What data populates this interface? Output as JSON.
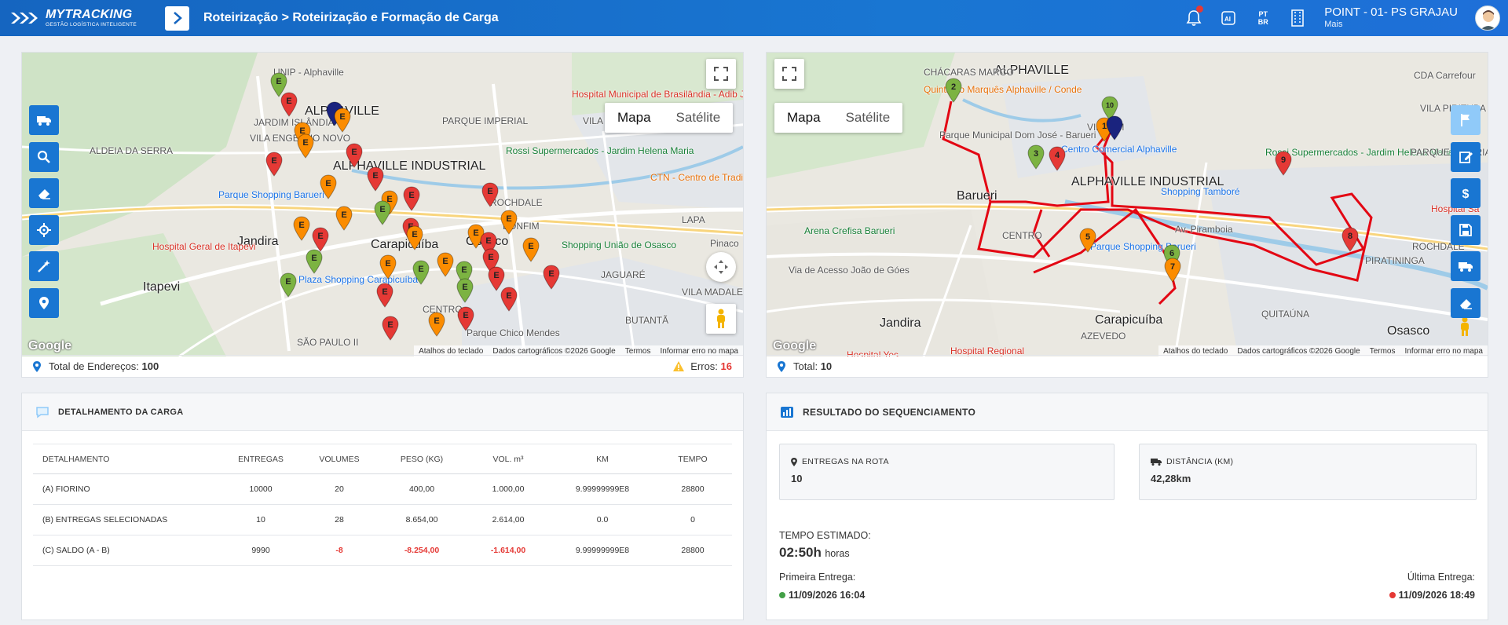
{
  "header": {
    "logo_main": "MYTRACKING",
    "logo_sub": "GESTÃO LOGÍSTICA INTELIGENTE",
    "breadcrumb": "Roteirização > Roteirização e Formação de Carga",
    "lang_top": "PT",
    "lang_bottom": "BR",
    "user_name": "POINT - 01- PS GRAJAU",
    "user_sub": "Mais"
  },
  "map_left": {
    "type_map": "Mapa",
    "type_satellite": "Satélite",
    "footer": [
      "Atalhos do teclado",
      "Dados cartográficos ©2026 Google",
      "Termos",
      "Informar erro no mapa"
    ],
    "google": "Google",
    "labels": [
      "UNIP - Alphaville",
      "ALPHAVILLE",
      "JARDIM ISLÂNDIA",
      "VILA ENGENHO NOVO",
      "ALDEIA DA SERRA",
      "Parque Shopping Barueri",
      "Jandira",
      "Hospital Geral de Itapevi",
      "Itapevi",
      "Carapicuíba",
      "Plaza Shopping Carapicuíba",
      "SÃO PAULO II",
      "Osasco",
      "ROCHDALE",
      "LAPA",
      "VILA MADALENA",
      "BUTANTÃ",
      "Rossi Supermercados - Jardim Helena Maria",
      "CTN - Centro de Tradições Nordestinas",
      "Shopping União de Osasco",
      "Hospital Municipal de Brasilândia - Adib Jatene",
      "VILA PIRITUBA",
      "PARQUE IMPERIAL",
      "ALPHAVILLE INDUSTRIAL",
      "Parque Chico Mendes",
      "JAGUARÉ",
      "Pinaco",
      "CENTRO",
      "BONFIM"
    ],
    "status_label": "Total de Endereços:",
    "status_value": "100",
    "errors_label": "Erros:",
    "errors_value": "16"
  },
  "map_right": {
    "type_map": "Mapa",
    "type_satellite": "Satélite",
    "footer": [
      "Atalhos do teclado",
      "Dados cartográficos ©2026 Google",
      "Termos",
      "Informar erro no mapa"
    ],
    "google": "Google",
    "labels": [
      "ALPHAVILLE",
      "CHÁCARAS MARCO",
      "Quinta do Marquês Alphaville / Conde",
      "Parque Municipal Dom José - Barueri",
      "Centro Comercial Alphaville",
      "Barueri",
      "ALPHAVILLE INDUSTRIAL",
      "Shopping Tamboré",
      "Arena Crefisa Barueri",
      "Parque Shopping Barueri",
      "Av. Piramboia",
      "CENTRO",
      "Jandira",
      "Carapicuíba",
      "Osasco",
      "ROCHDALE",
      "PIRATININGA",
      "QUITAÚNA",
      "Rossi Supermercados - Jardim Helena Maria",
      "CDA Carrefour",
      "Hospital Regional",
      "Hospital Yes",
      "VILA UM",
      "VILA PIRITUBA",
      "PARQUE IMPERIAL",
      "Via de Acesso João de Góes",
      "AZEVEDO",
      "Hospital Sa"
    ],
    "status_label": "Total:",
    "status_value": "10"
  },
  "detalhamento": {
    "title": "DETALHAMENTO DA CARGA",
    "columns": [
      "DETALHAMENTO",
      "ENTREGAS",
      "VOLUMES",
      "PESO (KG)",
      "VOL. m³",
      "KM",
      "TEMPO"
    ],
    "rows": [
      [
        "(A) FIORINO",
        "10000",
        "20",
        "400,00",
        "1.000,00",
        "9.99999999E8",
        "28800"
      ],
      [
        "(B) ENTREGAS SELECIONADAS",
        "10",
        "28",
        "8.654,00",
        "2.614,00",
        "0.0",
        "0"
      ],
      [
        "(C) SALDO (A - B)",
        "9990",
        "-8",
        "-8.254,00",
        "-1.614,00",
        "9.99999999E8",
        "28800"
      ]
    ]
  },
  "resultado": {
    "title": "RESULTADO DO SEQUENCIAMENTO",
    "entregas_label": "ENTREGAS NA ROTA",
    "entregas_value": "10",
    "distancia_label": "DISTÂNCIA (KM)",
    "distancia_value": "42,28km",
    "tempo_label": "TEMPO ESTIMADO:",
    "tempo_value": "02:50h",
    "tempo_unit": "horas",
    "primeira_label": "Primeira Entrega:",
    "primeira_value": "11/09/2026 16:04",
    "ultima_label": "Última Entrega:",
    "ultima_value": "11/09/2026 18:49"
  },
  "markers_left": [
    {
      "t": "E",
      "c": "#7cb342"
    },
    {
      "t": "E",
      "c": "#e53935"
    },
    {
      "t": "E",
      "c": "#fb8c00"
    },
    {
      "t": "E",
      "c": "#fb8c00"
    },
    {
      "t": "E",
      "c": "#e53935"
    },
    {
      "t": "",
      "c": "#1a237e"
    },
    {
      "t": "E",
      "c": "#fb8c00"
    },
    {
      "t": "E",
      "c": "#e53935"
    },
    {
      "t": "E",
      "c": "#fb8c00"
    },
    {
      "t": "E",
      "c": "#e53935"
    },
    {
      "t": "E",
      "c": "#fb8c00"
    },
    {
      "t": "E",
      "c": "#7cb342"
    },
    {
      "t": "E",
      "c": "#e53935"
    },
    {
      "t": "E",
      "c": "#e53935"
    },
    {
      "t": "E",
      "c": "#fb8c00"
    },
    {
      "t": "E",
      "c": "#e53935"
    },
    {
      "t": "E",
      "c": "#fb8c00"
    },
    {
      "t": "E",
      "c": "#7cb342"
    },
    {
      "t": "E",
      "c": "#fb8c00"
    },
    {
      "t": "E",
      "c": "#e53935"
    },
    {
      "t": "E",
      "c": "#fb8c00"
    },
    {
      "t": "E",
      "c": "#e53935"
    },
    {
      "t": "E",
      "c": "#fb8c00"
    },
    {
      "t": "E",
      "c": "#7cb342"
    },
    {
      "t": "E",
      "c": "#e53935"
    },
    {
      "t": "E",
      "c": "#e53935"
    },
    {
      "t": "E",
      "c": "#fb8c00"
    },
    {
      "t": "E",
      "c": "#7cb342"
    },
    {
      "t": "E",
      "c": "#e53935"
    },
    {
      "t": "E",
      "c": "#7cb342"
    },
    {
      "t": "E",
      "c": "#e53935"
    },
    {
      "t": "E",
      "c": "#fb8c00"
    },
    {
      "t": "E",
      "c": "#e53935"
    },
    {
      "t": "E",
      "c": "#7cb342"
    },
    {
      "t": "E",
      "c": "#fb8c00"
    },
    {
      "t": "E",
      "c": "#e53935"
    },
    {
      "t": "E",
      "c": "#fb8c00"
    },
    {
      "t": "E",
      "c": "#e53935"
    }
  ],
  "markers_right": [
    {
      "t": "2",
      "c": "#7cb342"
    },
    {
      "t": "10",
      "c": "#7cb342"
    },
    {
      "t": "1",
      "c": "#fb8c00"
    },
    {
      "t": "",
      "c": "#1a237e"
    },
    {
      "t": "3",
      "c": "#7cb342"
    },
    {
      "t": "4",
      "c": "#e53935"
    },
    {
      "t": "9",
      "c": "#e53935"
    },
    {
      "t": "5",
      "c": "#fb8c00"
    },
    {
      "t": "6",
      "c": "#7cb342"
    },
    {
      "t": "7",
      "c": "#fb8c00"
    },
    {
      "t": "8",
      "c": "#e53935"
    }
  ],
  "colors": {
    "primary": "#1976d2",
    "error": "#e53935",
    "route": "#e30613"
  },
  "icons": {
    "left_tools": [
      "truck-icon",
      "search-icon",
      "eraser-icon",
      "crosshair-icon",
      "magic-wand-icon",
      "map-pin-icon"
    ],
    "right_tools": [
      "flag-icon",
      "edit-icon",
      "dollar-icon",
      "save-icon",
      "truck-icon",
      "eraser-icon"
    ]
  }
}
